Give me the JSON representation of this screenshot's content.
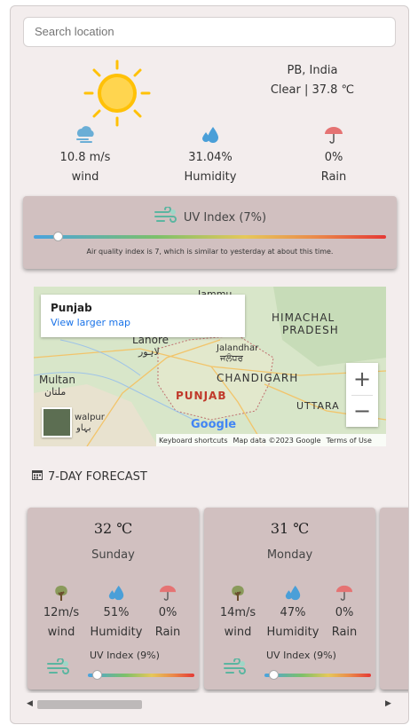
{
  "search": {
    "placeholder": "Search location"
  },
  "current": {
    "location": "PB, India",
    "condition": "Clear | 37.8 ℃",
    "wind": {
      "value": "10.8 m/s",
      "label": "wind"
    },
    "humidity": {
      "value": "31.04%",
      "label": "Humidity"
    },
    "rain": {
      "value": "0%",
      "label": "Rain"
    }
  },
  "uv": {
    "title": "UV Index (7%)",
    "level_fraction": 0.07,
    "note": "Air quality index is 7, which is similar to yesterday at about this time."
  },
  "map": {
    "place": "Punjab",
    "link": "View larger map",
    "zoom_in": "+",
    "zoom_out": "−",
    "labels": {
      "jammu": "Jammu",
      "himachal": "HIMACHAL",
      "pradesh": "PRADESH",
      "lahore": "Lahore",
      "lahore_ur": "لاہور",
      "jalandhar": "Jalandhar",
      "jalandhar_pa": "ਜਲੰਧਰ",
      "multan": "Multan",
      "multan_ur": "ملتان",
      "punjab": "PUNJAB",
      "chandigarh": "CHANDIGARH",
      "uttara": "UTTARA",
      "bahawalpur": "walpur",
      "bahawalpur_ur": "بہاو"
    },
    "google": "Google",
    "footer": {
      "shortcuts": "Keyboard shortcuts",
      "mapdata": "Map data ©2023 Google",
      "terms": "Terms of Use"
    }
  },
  "forecast": {
    "heading": "7-DAY FORECAST",
    "days": [
      {
        "temp": "32 ℃",
        "day": "Sunday",
        "wind": "12m/s",
        "wind_label": "wind",
        "humidity": "51%",
        "humidity_label": "Humidity",
        "rain": "0%",
        "rain_label": "Rain",
        "uv": "UV Index (9%)",
        "uv_fraction": 0.09
      },
      {
        "temp": "31 ℃",
        "day": "Monday",
        "wind": "14m/s",
        "wind_label": "wind",
        "humidity": "47%",
        "humidity_label": "Humidity",
        "rain": "0%",
        "rain_label": "Rain",
        "uv": "UV Index (9%)",
        "uv_fraction": 0.09
      }
    ]
  },
  "scroll": {
    "left_arrow": "◀",
    "right_arrow": "▶"
  },
  "colors": {
    "panel_bg": "#f3eded",
    "card_bg": "#d1c0c0",
    "sun": "#ffc107",
    "drop": "#4a9fd8",
    "umbrella": "#e57373",
    "wind_icon": "#6aaed6",
    "uv_icon": "#5bb5a0",
    "link": "#1a73e8"
  },
  "icons": {
    "sun": "sun-icon",
    "wind": "wind-icon",
    "humidity": "water-drop-icon",
    "rain": "umbrella-icon",
    "uv": "wind-gauge-icon",
    "calendar": "calendar-icon",
    "tree": "tree-icon"
  }
}
